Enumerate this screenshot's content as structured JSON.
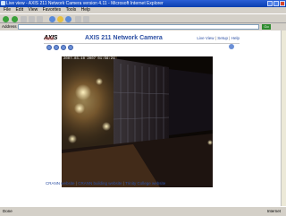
{
  "window": {
    "title": "Live view - AXIS 211 Network Camera version 4.11 - Microsoft Internet Explorer"
  },
  "menu": [
    "File",
    "Edit",
    "View",
    "Favorites",
    "Tools",
    "Help"
  ],
  "address": {
    "label": "Address",
    "go_label": "Go"
  },
  "page": {
    "logo_text": "AXIS",
    "title": "AXIS 211 Network Camera",
    "links": [
      "Live View",
      "Setup",
      "Help"
    ]
  },
  "video": {
    "timestamp": "2007-03-10 2007 01:56:24"
  },
  "footer": {
    "links": [
      "CRANN website",
      "CRANN building website",
      "Trinity College website"
    ]
  },
  "status": {
    "text": "Done",
    "zone": "Internet"
  }
}
